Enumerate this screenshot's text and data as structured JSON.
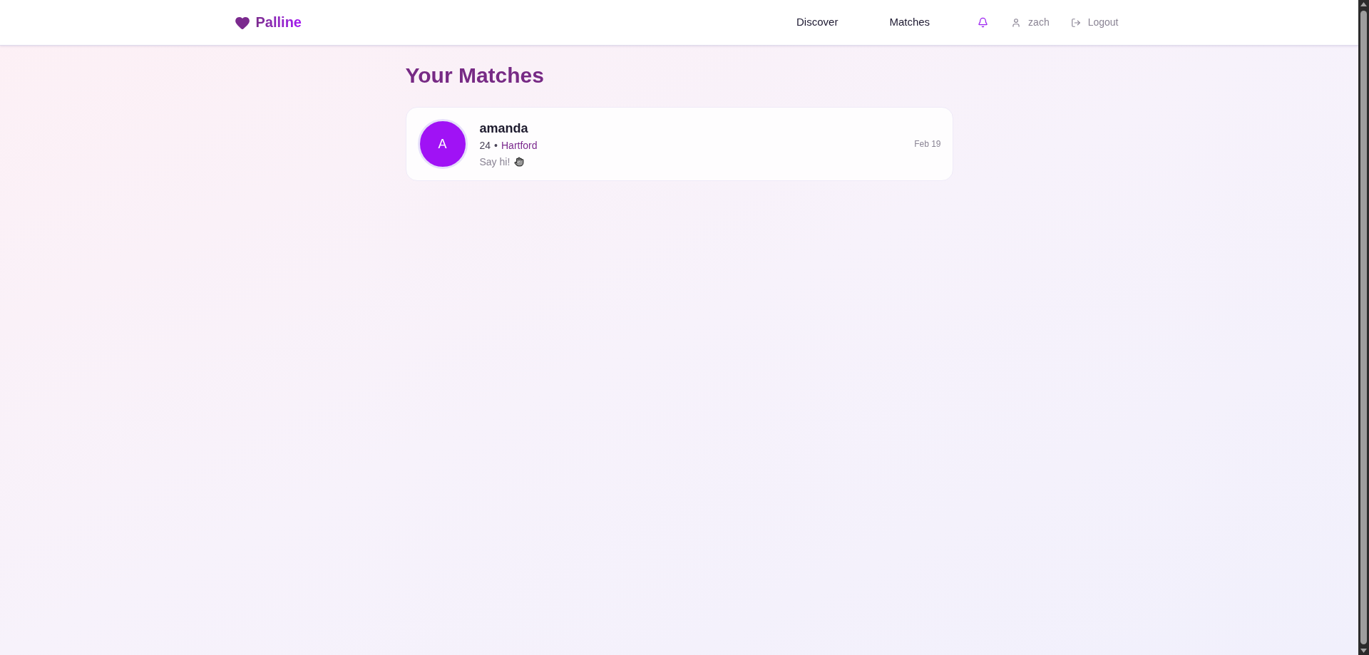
{
  "header": {
    "logo": {
      "text": "Palline"
    },
    "nav": [
      {
        "label": "Discover"
      },
      {
        "label": "Matches"
      }
    ],
    "user": {
      "name": "zach"
    },
    "logout": {
      "label": "Logout"
    }
  },
  "main": {
    "title": "Your Matches",
    "matches": [
      {
        "initial": "A",
        "name": "amanda",
        "age": "24",
        "separator": "•",
        "location": "Hartford",
        "message": "Say hi!",
        "date": "Feb 19"
      }
    ]
  }
}
